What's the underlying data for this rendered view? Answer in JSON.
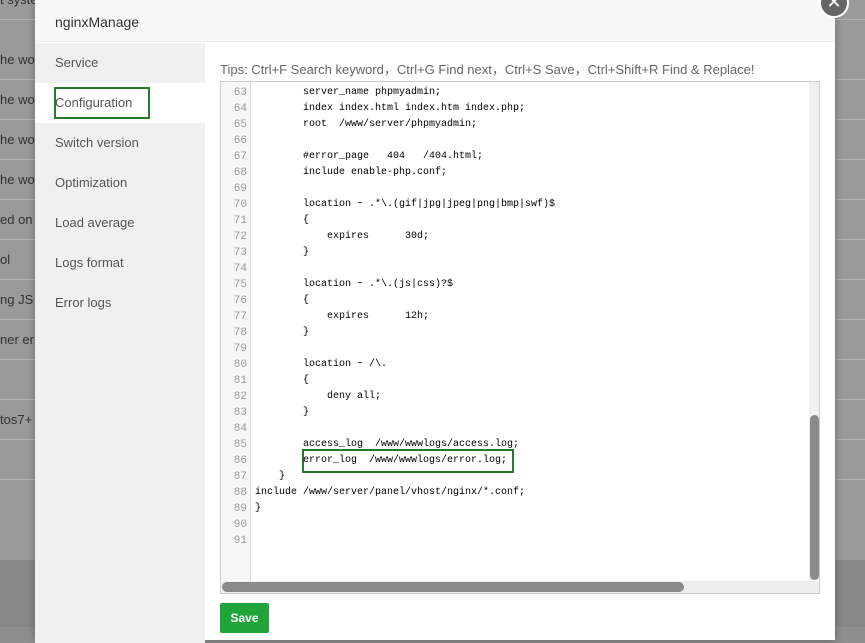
{
  "background": {
    "rows": [
      "t system",
      "he wo",
      "he wo",
      "he wo",
      "he wo",
      "ed on",
      "ol",
      "ng JS",
      "ner er",
      "",
      "tos7+",
      ""
    ]
  },
  "dialog": {
    "title": "nginxManage",
    "close_icon": "close-icon",
    "sidebar": {
      "items": [
        {
          "label": "Service"
        },
        {
          "label": "Configuration",
          "active": true
        },
        {
          "label": "Switch version"
        },
        {
          "label": "Optimization"
        },
        {
          "label": "Load average"
        },
        {
          "label": "Logs format"
        },
        {
          "label": "Error logs"
        }
      ]
    },
    "tips": "Tips:  Ctrl+F Search keyword，Ctrl+G Find next，Ctrl+S Save，Ctrl+Shift+R Find & Replace!",
    "editor": {
      "lines": [
        {
          "n": "63",
          "t": "        server_name phpmyadmin;"
        },
        {
          "n": "64",
          "t": "        index index.html index.htm index.php;"
        },
        {
          "n": "65",
          "t": "        root  /www/server/phpmyadmin;"
        },
        {
          "n": "66",
          "t": ""
        },
        {
          "n": "67",
          "t": "        #error_page   404   /404.html;"
        },
        {
          "n": "68",
          "t": "        include enable-php.conf;"
        },
        {
          "n": "69",
          "t": ""
        },
        {
          "n": "70",
          "t": "        location ~ .*\\.(gif|jpg|jpeg|png|bmp|swf)$"
        },
        {
          "n": "71",
          "t": "        {"
        },
        {
          "n": "72",
          "t": "            expires      30d;"
        },
        {
          "n": "73",
          "t": "        }"
        },
        {
          "n": "74",
          "t": ""
        },
        {
          "n": "75",
          "t": "        location ~ .*\\.(js|css)?$"
        },
        {
          "n": "76",
          "t": "        {"
        },
        {
          "n": "77",
          "t": "            expires      12h;"
        },
        {
          "n": "78",
          "t": "        }"
        },
        {
          "n": "79",
          "t": ""
        },
        {
          "n": "80",
          "t": "        location ~ /\\."
        },
        {
          "n": "81",
          "t": "        {"
        },
        {
          "n": "82",
          "t": "            deny all;"
        },
        {
          "n": "83",
          "t": "        }"
        },
        {
          "n": "84",
          "t": ""
        },
        {
          "n": "85",
          "t": "        access_log  /www/wwwlogs/access.log;"
        },
        {
          "n": "86",
          "t": "        error_log  /www/wwwlogs/error.log;"
        },
        {
          "n": "87",
          "t": "    }"
        },
        {
          "n": "88",
          "t": "include /www/server/panel/vhost/nginx/*.conf;"
        },
        {
          "n": "89",
          "t": "}"
        },
        {
          "n": "90",
          "t": ""
        },
        {
          "n": "91",
          "t": ""
        }
      ]
    },
    "save_label": "Save"
  },
  "colors": {
    "accent": "#20a53a",
    "highlight": "#2b7a2b"
  }
}
